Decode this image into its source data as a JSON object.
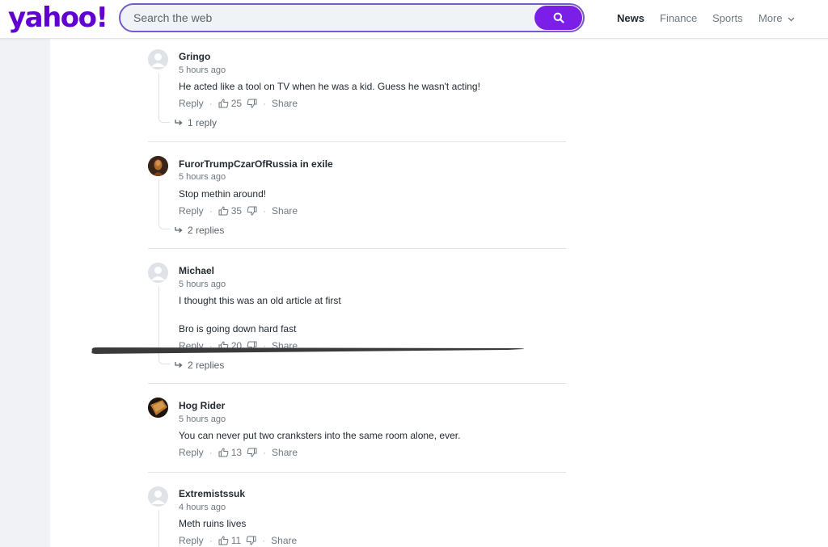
{
  "header": {
    "logo": "yahoo!",
    "search_placeholder": "Search the web",
    "nav": [
      "News",
      "Finance",
      "Sports",
      "More"
    ]
  },
  "comments": [
    {
      "user": "Gringo",
      "time": "5 hours ago",
      "text": [
        "He acted like a tool on TV when he was a kid. Guess he wasn't acting!"
      ],
      "reply_label": "Reply",
      "likes": "25",
      "share_label": "Share",
      "replies": "1 reply"
    },
    {
      "user": "FurorTrumpCzarOfRussia in exile",
      "time": "5 hours ago",
      "text": [
        "Stop methin around!"
      ],
      "reply_label": "Reply",
      "likes": "35",
      "share_label": "Share",
      "replies": "2 replies"
    },
    {
      "user": "Michael",
      "time": "5 hours ago",
      "text": [
        "I thought this was an old article at first",
        "Bro is going down hard fast"
      ],
      "reply_label": "Reply",
      "likes": "20",
      "share_label": "Share",
      "replies": "2 replies"
    },
    {
      "user": "Hog Rider",
      "time": "5 hours ago",
      "text": [
        "You can never put two cranksters into the same room alone, ever."
      ],
      "reply_label": "Reply",
      "likes": "13",
      "share_label": "Share"
    },
    {
      "user": "Extremistssuk",
      "time": "4 hours ago",
      "text": [
        "Meth ruins lives"
      ],
      "reply_label": "Reply",
      "likes": "11",
      "share_label": "Share"
    }
  ],
  "colors": {
    "brand": "#6001d2",
    "search_button": "#7a1ee8"
  }
}
